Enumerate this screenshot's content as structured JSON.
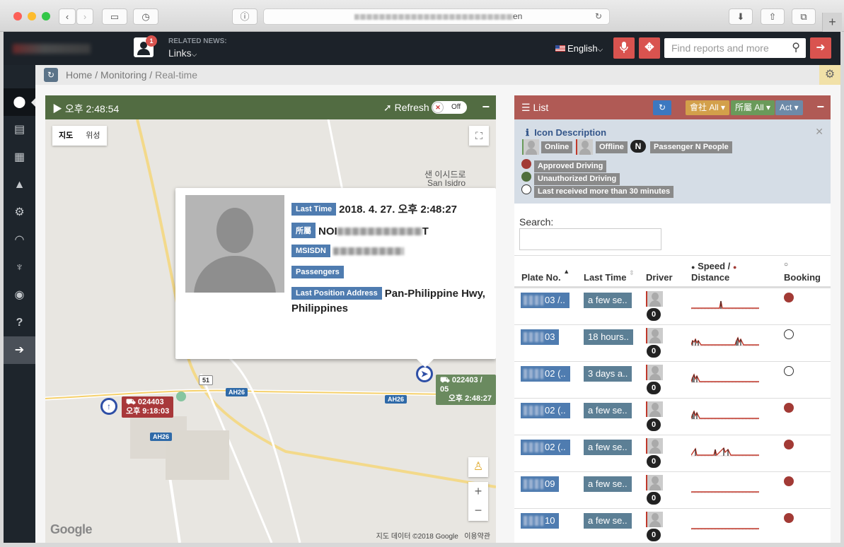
{
  "browser": {
    "url_tail": "en",
    "new_tab": "+"
  },
  "header": {
    "news_badge": "1",
    "news_label": "RELATED NEWS:",
    "links": "Links",
    "language": "English",
    "search_placeholder": "Find reports and more"
  },
  "breadcrumb": {
    "home": "Home",
    "monitoring": "Monitoring",
    "current": "Real-time",
    "sep": "/"
  },
  "map": {
    "time": "오후 2:48:54",
    "refresh": "Refresh",
    "toggle": "Off",
    "type_map": "지도",
    "type_sat": "위성",
    "place1": "샌 이시드로",
    "place2": "San Isidro",
    "road_shields": [
      "51",
      "AH26",
      "AH26",
      "AH26"
    ],
    "vehicle1_plate": "024403",
    "vehicle1_time": "오후 9:18:03",
    "vehicle2_plate": "022403 / 05",
    "vehicle2_time": "오후 2:48:27",
    "attribution": "지도 데이터 ©2018 Google",
    "terms": "이용약관",
    "google": "Google"
  },
  "popup": {
    "last_time_label": "Last Time",
    "last_time_value": "2018. 4. 27. 오후 2:48:27",
    "org_label": "所屬",
    "org_value_start": "NOI",
    "org_value_end": "T",
    "msisdn_label": "MSISDN",
    "passengers_label": "Passengers",
    "address_label": "Last Position Address",
    "address_value": "Pan-Philippine Hwy,",
    "address_value2": "Philippines"
  },
  "list": {
    "title": "List",
    "company_filter": "會社 All",
    "org_filter": "所屬 All",
    "act": "Act",
    "icon_desc_title": "Icon Description",
    "online": "Online",
    "offline": "Offline",
    "passenger_n": "N",
    "passenger_label": "Passenger N People",
    "approved": "Approved Driving",
    "unauthorized": "Unauthorized Driving",
    "stale": "Last received more than 30 minutes",
    "search_label": "Search:",
    "columns": {
      "plate": "Plate No.",
      "last_time": "Last Time",
      "driver": "Driver",
      "speed": "Speed /",
      "distance": "Distance",
      "booking": "Booking"
    },
    "rows": [
      {
        "plate": "03 /..",
        "time": "a few se..",
        "count": "0",
        "booking": true
      },
      {
        "plate": "03",
        "time": "18 hours..",
        "count": "0",
        "booking": false
      },
      {
        "plate": "02 (..",
        "time": "3 days a..",
        "count": "0",
        "booking": false
      },
      {
        "plate": "02 (..",
        "time": "a few se..",
        "count": "0",
        "booking": true
      },
      {
        "plate": "02 (..",
        "time": "a few se..",
        "count": "0",
        "booking": true
      },
      {
        "plate": "09",
        "time": "a few se..",
        "count": "0",
        "booking": true
      },
      {
        "plate": "10",
        "time": "a few se..",
        "count": "0",
        "booking": true
      }
    ]
  },
  "colors": {
    "map_header": "#526c42",
    "list_header": "#b05a55",
    "accent_red": "#d9534f",
    "tag_blue": "#4f7cb0"
  }
}
